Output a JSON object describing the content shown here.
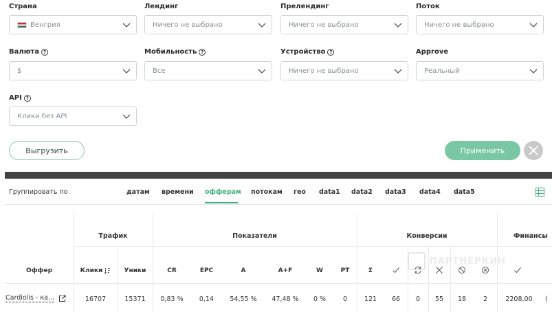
{
  "filters": {
    "country": {
      "label": "Страна",
      "value": "Венгрия",
      "flag": "hungary-flag-icon"
    },
    "landing": {
      "label": "Лендинг",
      "placeholder": "Ничего не выбрано"
    },
    "prelanding": {
      "label": "Прелендинг",
      "placeholder": "Ничего не выбрано"
    },
    "stream": {
      "label": "Поток",
      "placeholder": "Ничего не выбрано"
    },
    "currency": {
      "label": "Валюта",
      "value": "$"
    },
    "mobility": {
      "label": "Мобильность",
      "value": "Все"
    },
    "device": {
      "label": "Устройство",
      "placeholder": "Ничего не выбрано"
    },
    "approve": {
      "label": "Approve",
      "value": "Реальный"
    },
    "api": {
      "label": "API",
      "value": "Клики без API"
    },
    "help_glyph": "?"
  },
  "actions": {
    "export_label": "Выгрузить",
    "apply_label": "Применить"
  },
  "grouping": {
    "label": "Группировать по",
    "tabs": [
      "датам",
      "времени",
      "офферам",
      "потокам",
      "гео",
      "data1",
      "data2",
      "data3",
      "data4",
      "data5"
    ],
    "active": "офферам"
  },
  "table": {
    "groups": {
      "traffic": "Трафик",
      "indicators": "Показатели",
      "conversions": "Конверсии",
      "finance": "Финансы"
    },
    "columns": {
      "offer": "Оффер",
      "clicks": "Клики",
      "uniques": "Уники",
      "cr": "CR",
      "epc": "EPC",
      "a": "A",
      "af": "A+F",
      "w": "W",
      "pt": "PT",
      "sum": "Σ"
    },
    "row": {
      "offer": "Cardiolis - ка...",
      "clicks": "16707",
      "uniques": "15371",
      "cr": "0,83 %",
      "epc": "0,14",
      "a": "54,55 %",
      "af": "47,48 %",
      "w": "0 %",
      "pt": "0",
      "sum": "121",
      "approved": "66",
      "processing": "0",
      "rejected": "55",
      "cancelled": "18",
      "trash": "2",
      "finance_approved": "2208,00",
      "finance_next": "("
    }
  },
  "watermark": "ПАРТНЕРКИН",
  "colors": {
    "accent": "#3fae7d",
    "apply_bg": "#79c7a4",
    "divider": "#424242"
  }
}
